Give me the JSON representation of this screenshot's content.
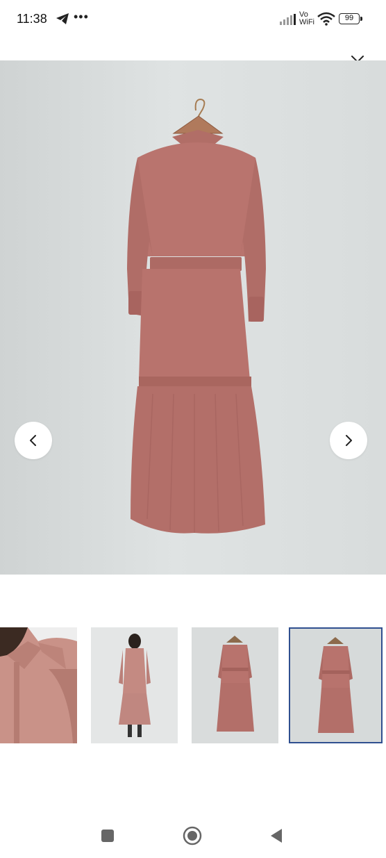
{
  "status_bar": {
    "time": "11:38",
    "more": "•••",
    "network": "Vo WiFi",
    "network_top": "Vo",
    "network_bottom": "WiFi",
    "battery": "99"
  },
  "viewer": {
    "close_icon": "close-icon",
    "prev_icon": "chevron-left-icon",
    "next_icon": "chevron-right-icon",
    "product_color": "#b9746e"
  },
  "thumbnails": [
    {
      "subject": "close-up-collar"
    },
    {
      "subject": "model-back-view"
    },
    {
      "subject": "dress-front-on-hanger"
    },
    {
      "subject": "dress-back-on-hanger",
      "selected": true
    }
  ],
  "selected_thumb_border_color": "#2f4f8f"
}
